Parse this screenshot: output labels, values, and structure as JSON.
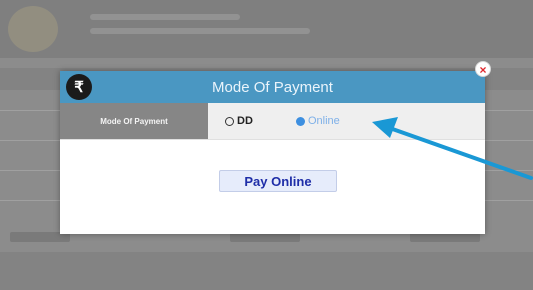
{
  "modal": {
    "title": "Mode Of Payment",
    "title_icon": "rupee-icon",
    "title_icon_glyph": "₹",
    "close_icon": "close-icon",
    "close_glyph": "×"
  },
  "mode_row": {
    "label": "Mode Of Payment",
    "options": [
      {
        "label": "DD",
        "selected": false
      },
      {
        "label": "Online",
        "selected": true
      }
    ]
  },
  "pay_button": {
    "label": "Pay Online"
  },
  "colors": {
    "header_bg": "#4a97c2",
    "button_text": "#1f2ea8",
    "arrow": "#1a98d5"
  }
}
